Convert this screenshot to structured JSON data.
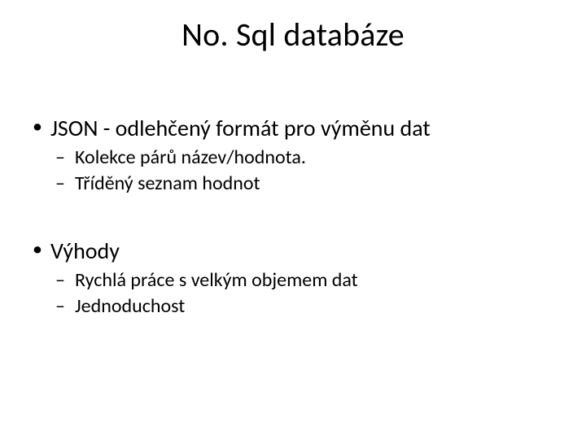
{
  "title": "No. Sql databáze",
  "bullets": [
    {
      "text": "JSON - odlehčený formát pro výměnu dat",
      "sub": [
        "Kolekce párů název/hodnota.",
        "Tříděný seznam hodnot"
      ]
    },
    {
      "text": "Výhody",
      "sub": [
        "Rychlá práce s velkým objemem dat",
        "Jednoduchost"
      ]
    }
  ]
}
